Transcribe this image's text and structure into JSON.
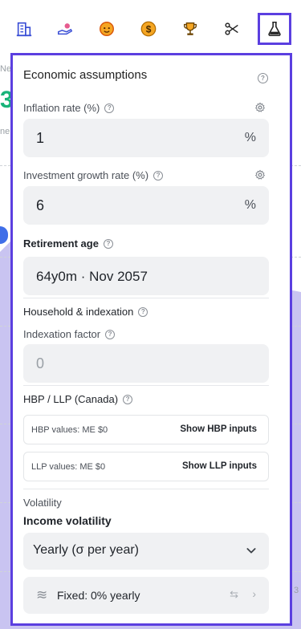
{
  "toolbar": {
    "icons": [
      "building-icon",
      "hand-coin-icon",
      "face-icon",
      "dollar-icon",
      "trophy-icon",
      "scissors-icon",
      "flask-icon"
    ]
  },
  "background": {
    "label_ne_1": "Ne",
    "big_number": "3",
    "label_ne_2": "ne",
    "right_digit": "3"
  },
  "panel": {
    "title": "Economic assumptions",
    "inflation": {
      "label": "Inflation rate (%)",
      "value": "1",
      "unit": "%"
    },
    "investment": {
      "label": "Investment growth rate (%)",
      "value": "6",
      "unit": "%"
    },
    "retirement": {
      "label": "Retirement age",
      "value": "64y0m · Nov 2057"
    },
    "household": {
      "label": "Household & indexation"
    },
    "indexation": {
      "label": "Indexation factor",
      "value": "0"
    },
    "hbp": {
      "label": "HBP / LLP (Canada)",
      "hbp_values": "HBP values: ME $0",
      "hbp_button": "Show HBP inputs",
      "llp_values": "LLP values: ME $0",
      "llp_button": "Show LLP inputs"
    },
    "volatility": {
      "section": "Volatility",
      "label": "Income volatility",
      "select_value": "Yearly (σ per year)",
      "fixed_label": "Fixed: 0% yearly"
    }
  },
  "colors": {
    "accent": "#5b3fe0",
    "chart_fill": "#c9c4f1",
    "green": "#19b37a",
    "orange": "#f07d12"
  }
}
